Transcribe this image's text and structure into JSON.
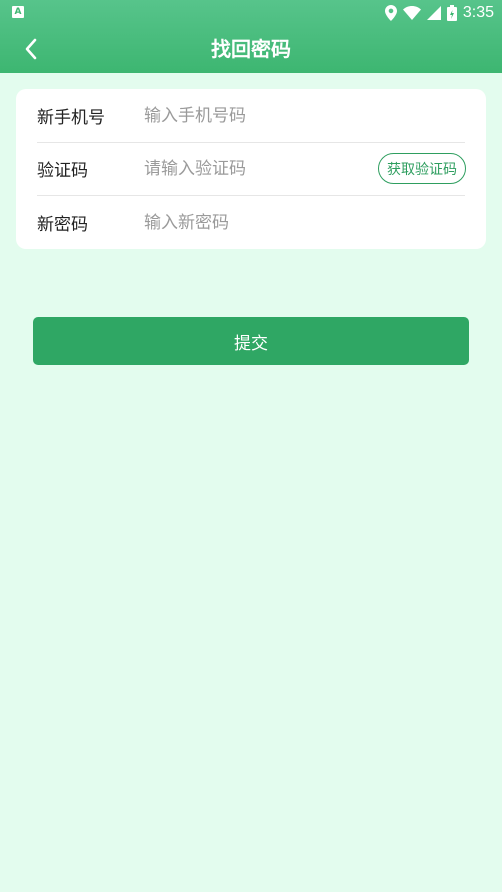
{
  "status_bar": {
    "time": "3:35",
    "notification_icon": "a-icon",
    "icons": [
      "location-icon",
      "wifi-icon",
      "signal-icon",
      "battery-icon"
    ]
  },
  "header": {
    "title": "找回密码",
    "back_icon": "chevron-left-icon"
  },
  "form": {
    "phone": {
      "label": "新手机号",
      "placeholder": "输入手机号码",
      "value": ""
    },
    "code": {
      "label": "验证码",
      "placeholder": "请输入验证码",
      "value": "",
      "button_label": "获取验证码"
    },
    "password": {
      "label": "新密码",
      "placeholder": "输入新密码",
      "value": ""
    }
  },
  "submit_label": "提交",
  "colors": {
    "header_top": "#57c48b",
    "header_bottom": "#3db671",
    "background": "#e3fcee",
    "accent": "#2fa764"
  }
}
